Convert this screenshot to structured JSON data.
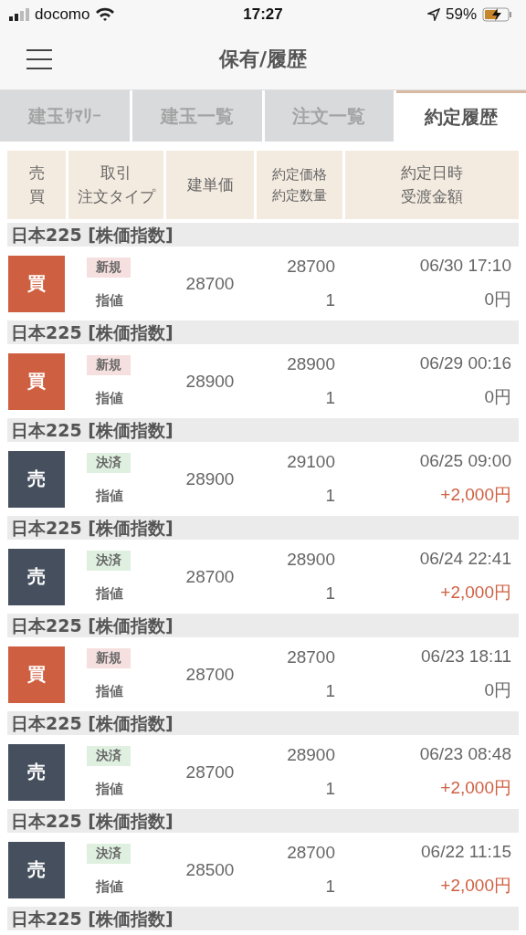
{
  "status_bar": {
    "carrier": "docomo",
    "time": "17:27",
    "battery": "59%"
  },
  "header": {
    "title": "保有/履歴"
  },
  "tabs": [
    {
      "label": "建玉ｻﾏﾘｰ",
      "selected": false
    },
    {
      "label": "建玉一覧",
      "selected": false
    },
    {
      "label": "注文一覧",
      "selected": false
    },
    {
      "label": "約定履歴",
      "selected": true
    }
  ],
  "columns": [
    [
      "売",
      "買"
    ],
    [
      "取引",
      "注文タイプ"
    ],
    [
      "建単価"
    ],
    [
      "約定価格",
      "約定数量"
    ],
    [
      "約定日時",
      "受渡金額"
    ]
  ],
  "trades": [
    {
      "instrument": "日本225 [株価指数]",
      "side": {
        "kind": "buy",
        "label": "買"
      },
      "tag": {
        "kind": "new",
        "label": "新規"
      },
      "order_type": "指値",
      "entry_price": "28700",
      "fill_price": "28700",
      "quantity": "1",
      "datetime": "06/30 17:10",
      "amount": "0円",
      "profit": false
    },
    {
      "instrument": "日本225 [株価指数]",
      "side": {
        "kind": "buy",
        "label": "買"
      },
      "tag": {
        "kind": "new",
        "label": "新規"
      },
      "order_type": "指値",
      "entry_price": "28900",
      "fill_price": "28900",
      "quantity": "1",
      "datetime": "06/29 00:16",
      "amount": "0円",
      "profit": false
    },
    {
      "instrument": "日本225 [株価指数]",
      "side": {
        "kind": "sell",
        "label": "売"
      },
      "tag": {
        "kind": "close",
        "label": "決済"
      },
      "order_type": "指値",
      "entry_price": "28900",
      "fill_price": "29100",
      "quantity": "1",
      "datetime": "06/25 09:00",
      "amount": "+2,000円",
      "profit": true
    },
    {
      "instrument": "日本225 [株価指数]",
      "side": {
        "kind": "sell",
        "label": "売"
      },
      "tag": {
        "kind": "close",
        "label": "決済"
      },
      "order_type": "指値",
      "entry_price": "28700",
      "fill_price": "28900",
      "quantity": "1",
      "datetime": "06/24 22:41",
      "amount": "+2,000円",
      "profit": true
    },
    {
      "instrument": "日本225 [株価指数]",
      "side": {
        "kind": "buy",
        "label": "買"
      },
      "tag": {
        "kind": "new",
        "label": "新規"
      },
      "order_type": "指値",
      "entry_price": "28700",
      "fill_price": "28700",
      "quantity": "1",
      "datetime": "06/23 18:11",
      "amount": "0円",
      "profit": false
    },
    {
      "instrument": "日本225 [株価指数]",
      "side": {
        "kind": "sell",
        "label": "売"
      },
      "tag": {
        "kind": "close",
        "label": "決済"
      },
      "order_type": "指値",
      "entry_price": "28700",
      "fill_price": "28900",
      "quantity": "1",
      "datetime": "06/23 08:48",
      "amount": "+2,000円",
      "profit": true
    },
    {
      "instrument": "日本225 [株価指数]",
      "side": {
        "kind": "sell",
        "label": "売"
      },
      "tag": {
        "kind": "close",
        "label": "決済"
      },
      "order_type": "指値",
      "entry_price": "28500",
      "fill_price": "28700",
      "quantity": "1",
      "datetime": "06/22 11:15",
      "amount": "+2,000円",
      "profit": true
    }
  ],
  "trailing_group": {
    "instrument": "日本225 [株価指数]"
  }
}
